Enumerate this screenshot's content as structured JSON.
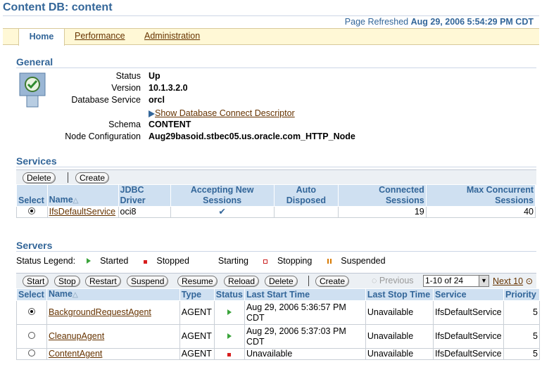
{
  "page": {
    "title": "Content DB: content",
    "refreshed_label": "Page Refreshed",
    "refreshed_value": "Aug 29, 2006 5:54:29 PM CDT"
  },
  "tabs": [
    {
      "label": "Home"
    },
    {
      "label": "Performance"
    },
    {
      "label": "Administration"
    }
  ],
  "general": {
    "heading": "General",
    "status_label": "Status",
    "status": "Up",
    "version_label": "Version",
    "version": "10.1.3.2.0",
    "service_label": "Database Service",
    "service": "orcl",
    "connect_link": "Show Database Connect Descriptor",
    "schema_label": "Schema",
    "schema": "CONTENT",
    "node_label": "Node Configuration",
    "node": "Aug29basoid.stbec05.us.oracle.com_HTTP_Node"
  },
  "services": {
    "heading": "Services",
    "buttons": {
      "delete": "Delete",
      "create": "Create"
    },
    "columns": {
      "select": "Select",
      "name": "Name",
      "jdbc": "JDBC Driver",
      "accepting": "Accepting New Sessions",
      "auto": "Auto Disposed",
      "connected": "Connected Sessions",
      "maxc": "Max Concurrent Sessions"
    },
    "rows": [
      {
        "name": "IfsDefaultService",
        "jdbc": "oci8",
        "accepting": "✔",
        "auto": "",
        "connected": "19",
        "maxc": "40"
      }
    ]
  },
  "servers": {
    "heading": "Servers",
    "legend_label": "Status Legend:",
    "legend": {
      "started": "Started",
      "stopped": "Stopped",
      "starting": "Starting",
      "stopping": "Stopping",
      "suspended": "Suspended"
    },
    "buttons": {
      "start": "Start",
      "stop": "Stop",
      "restart": "Restart",
      "suspend": "Suspend",
      "resume": "Resume",
      "reload": "Reload",
      "delete": "Delete",
      "create": "Create"
    },
    "pager": {
      "previous": "Previous",
      "range": "1-10 of 24",
      "next": "Next 10"
    },
    "columns": {
      "select": "Select",
      "name": "Name",
      "type": "Type",
      "status": "Status",
      "last_start": "Last Start Time",
      "last_stop": "Last Stop Time",
      "service": "Service",
      "priority": "Priority"
    },
    "rows": [
      {
        "name": "BackgroundRequestAgent",
        "type": "AGENT",
        "status": "started",
        "last_start": "Aug 29, 2006 5:36:57 PM CDT",
        "last_stop": "Unavailable",
        "service": "IfsDefaultService",
        "priority": "5"
      },
      {
        "name": "CleanupAgent",
        "type": "AGENT",
        "status": "started",
        "last_start": "Aug 29, 2006 5:37:03 PM CDT",
        "last_stop": "Unavailable",
        "service": "IfsDefaultService",
        "priority": "5"
      },
      {
        "name": "ContentAgent",
        "type": "AGENT",
        "status": "stopped",
        "last_start": "Unavailable",
        "last_stop": "Unavailable",
        "service": "IfsDefaultService",
        "priority": "5"
      }
    ]
  }
}
